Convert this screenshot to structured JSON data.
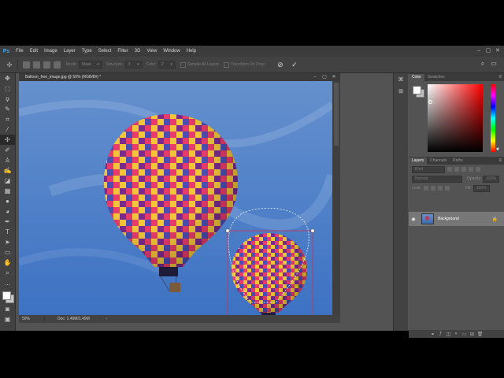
{
  "menubar": {
    "logo": "Ps",
    "items": [
      "File",
      "Edit",
      "Image",
      "Layer",
      "Type",
      "Select",
      "Filter",
      "3D",
      "View",
      "Window",
      "Help"
    ],
    "window_controls": [
      "–",
      "▢",
      "✕"
    ]
  },
  "options_bar": {
    "mode_label": "Mode:",
    "mode_value": "Mask",
    "structure_label": "Structure:",
    "structure_value": "3",
    "color_label": "Color:",
    "color_value": "2",
    "sample_all_layers": "Sample All Layers",
    "transform_on_drop": "Transform On Drop"
  },
  "document": {
    "tab_title": "Balloon_free_image.jpg @ 50% (RGB/8#) *",
    "zoom": "50%",
    "doc_size": "Doc: 1.49M/1.49M",
    "tab_controls": [
      "–",
      "▢",
      "✕"
    ]
  },
  "color_panel": {
    "tabs": [
      "Color",
      "Swatches"
    ],
    "foreground_color": "#ffffff",
    "background_color": "#c0c0c0"
  },
  "layers_panel": {
    "tabs": [
      "Layers",
      "Channels",
      "Paths"
    ],
    "filter_placeholder": "Kind",
    "blend_mode": "Normal",
    "opacity_label": "Opacity:",
    "opacity_value": "100%",
    "lock_label": "Lock:",
    "fill_label": "Fill:",
    "fill_value": "100%",
    "layers": [
      {
        "name": "Background",
        "visible": true,
        "locked": true
      }
    ]
  },
  "colors": {
    "app_bg": "#535353",
    "sky_top": "#5b89c9",
    "sky_bottom": "#3f74c4",
    "selection_handles": "#d0304f"
  }
}
